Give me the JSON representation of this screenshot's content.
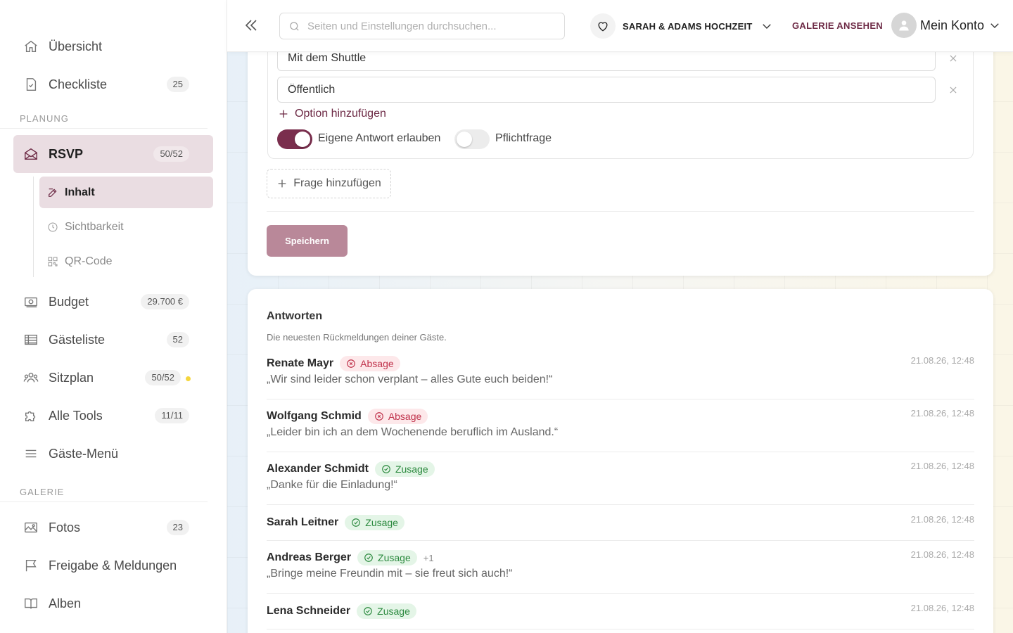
{
  "sidebar": {
    "items_top": [
      {
        "label": "Übersicht",
        "icon": "home-icon"
      },
      {
        "label": "Checkliste",
        "icon": "checklist-icon",
        "badge": "25"
      }
    ],
    "section_planning": "PLANUNG",
    "rsvp": {
      "label": "RSVP",
      "badge": "50/52"
    },
    "rsvp_sub": [
      {
        "label": "Inhalt",
        "icon": "edit-icon"
      },
      {
        "label": "Sichtbarkeit",
        "icon": "clock-icon"
      },
      {
        "label": "QR-Code",
        "icon": "qr-code-icon"
      }
    ],
    "items_planning": [
      {
        "label": "Budget",
        "badge": "29.700 €",
        "icon": "money-icon"
      },
      {
        "label": "Gästeliste",
        "badge": "52",
        "icon": "table-icon"
      },
      {
        "label": "Sitzplan",
        "badge": "50/52",
        "icon": "people-icon",
        "dot_color": "#f5d63d"
      },
      {
        "label": "Alle Tools",
        "badge": "11/11",
        "icon": "puzzle-icon"
      },
      {
        "label": "Gäste-Menü",
        "icon": "menu-icon"
      }
    ],
    "section_gallery": "GALERIE",
    "items_gallery": [
      {
        "label": "Fotos",
        "badge": "23",
        "icon": "image-icon"
      },
      {
        "label": "Freigabe & Meldungen",
        "icon": "flag-icon"
      },
      {
        "label": "Alben",
        "icon": "book-icon"
      }
    ]
  },
  "topbar": {
    "search_placeholder": "Seiten und Einstellungen durchsuchen...",
    "event_name": "SARAH & ADAMS HOCHZEIT",
    "gallery_link": "GALERIE ANSEHEN",
    "account_label": "Mein Konto"
  },
  "editor": {
    "options": [
      "Mit dem Shuttle",
      "Öffentlich"
    ],
    "add_option": "Option hinzufügen",
    "toggle_own_answer": {
      "label": "Eigene Antwort erlauben",
      "on": true
    },
    "toggle_required": {
      "label": "Pflichtfrage",
      "on": false
    },
    "add_question": "Frage hinzufügen",
    "save": "Speichern"
  },
  "answers": {
    "title": "Antworten",
    "subtitle": "Die neuesten Rückmeldungen deiner Gäste.",
    "rows": [
      {
        "name": "Renate Mayr",
        "status": "Absage",
        "type": "no",
        "message": "„Wir sind leider schon verplant – alles Gute euch beiden!“",
        "time": "21.08.26, 12:48"
      },
      {
        "name": "Wolfgang Schmid",
        "status": "Absage",
        "type": "no",
        "message": "„Leider bin ich an dem Wochenende beruflich im Ausland.“",
        "time": "21.08.26, 12:48"
      },
      {
        "name": "Alexander Schmidt",
        "status": "Zusage",
        "type": "yes",
        "message": "„Danke für die Einladung!“",
        "time": "21.08.26, 12:48"
      },
      {
        "name": "Sarah Leitner",
        "status": "Zusage",
        "type": "yes",
        "message": "",
        "time": "21.08.26, 12:48"
      },
      {
        "name": "Andreas Berger",
        "status": "Zusage",
        "type": "yes",
        "plus": "+1",
        "message": "„Bringe meine Freundin mit – sie freut sich auch!“",
        "time": "21.08.26, 12:48"
      },
      {
        "name": "Lena Schneider",
        "status": "Zusage",
        "type": "yes",
        "message": "",
        "time": "21.08.26, 12:48"
      }
    ]
  }
}
